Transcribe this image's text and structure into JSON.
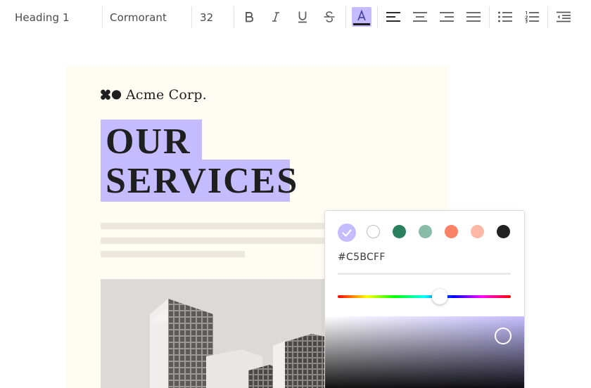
{
  "toolbar": {
    "block_style": "Heading 1",
    "font_family": "Cormorant",
    "font_size": "32",
    "buttons": [
      "bold",
      "italic",
      "underline",
      "strikethrough",
      "highlight-color",
      "align-left",
      "align-center",
      "align-right",
      "align-justify",
      "bullet-list",
      "numbered-list",
      "outdent"
    ],
    "active": "highlight-color"
  },
  "document": {
    "brand": "Acme Corp.",
    "heading_line1": "OUR",
    "heading_line2": "SERVICES",
    "highlight_color": "#C5BCFF"
  },
  "color_picker": {
    "swatches": [
      "#C5BCFF",
      "#FFFFFF",
      "#2A7F5F",
      "#88BBA8",
      "#FA8266",
      "#FFB8A6",
      "#222222"
    ],
    "selected_index": 0,
    "hex_value": "#C5BCFF"
  },
  "colors": {
    "accent": "#C5BCFF",
    "paper": "#FFFCF4",
    "text": "#1F1F1F"
  }
}
